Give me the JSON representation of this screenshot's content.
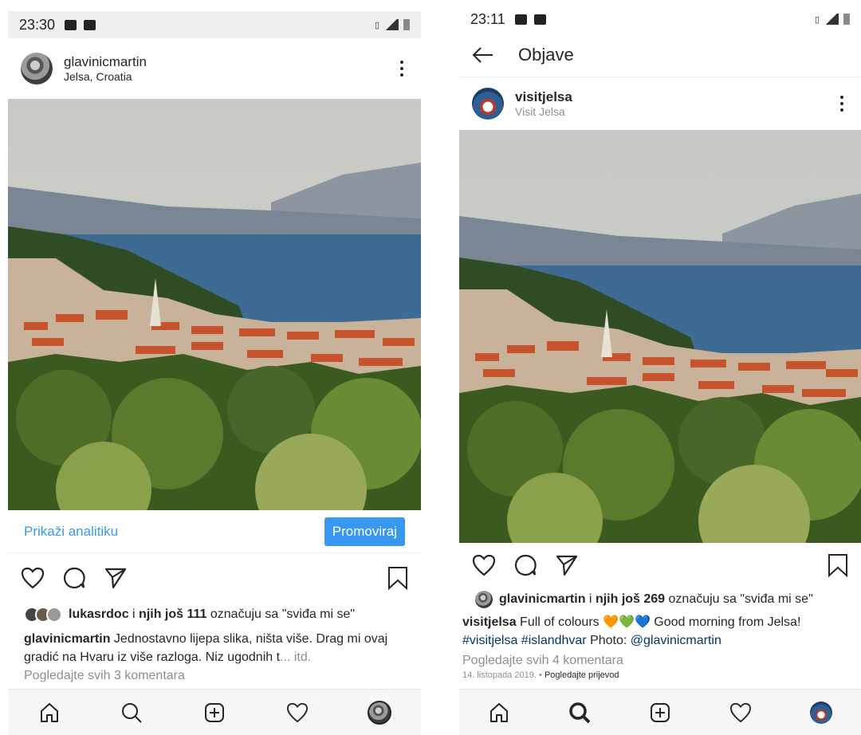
{
  "left": {
    "status": {
      "time": "23:30"
    },
    "post": {
      "username": "glavinicmartin",
      "location": "Jelsa, Croatia"
    },
    "analytics_label": "Prikaži analitiku",
    "promote_label": "Promoviraj",
    "likes": {
      "user": "lukasrdoc",
      "connector": " i ",
      "others": "njih još 111",
      "suffix": " označuju sa \"sviđa mi se\""
    },
    "caption": {
      "user": "glavinicmartin",
      "text": " Jednostavno lijepa slika, ništa više. Drag mi ovaj gradić na Hvaru iz više razloga. Niz ugodnih t",
      "more": "... itd."
    },
    "comments_link": "Pogledajte svih 3 komentara"
  },
  "right": {
    "status": {
      "time": "23:11"
    },
    "header_title": "Objave",
    "post": {
      "username": "visitjelsa",
      "subtitle": "Visit Jelsa"
    },
    "likes": {
      "user": "glavinicmartin",
      "connector": " i ",
      "others": "njih još 269",
      "suffix": " označuju sa \"sviđa mi se\""
    },
    "caption": {
      "user": "visitjelsa",
      "text": " Full of colours ",
      "hearts": "🧡💚💙",
      "text2": " Good morning from Jelsa!",
      "tags": "#visitjelsa #islandhvar",
      "photo_prefix": " Photo: ",
      "mention": "@glavinicmartin"
    },
    "comments_link": "Pogledajte svih 4 komentara",
    "date": "14. listopada 2019.",
    "translate_sep": " • ",
    "translate": "Pogledajte prijevod"
  },
  "nav_icons": [
    "home-icon",
    "search-icon",
    "new-post-icon",
    "activity-heart-icon",
    "profile-avatar"
  ],
  "colors": {
    "accent": "#3897f0",
    "link": "#00376b",
    "muted": "#8e8e8e"
  }
}
